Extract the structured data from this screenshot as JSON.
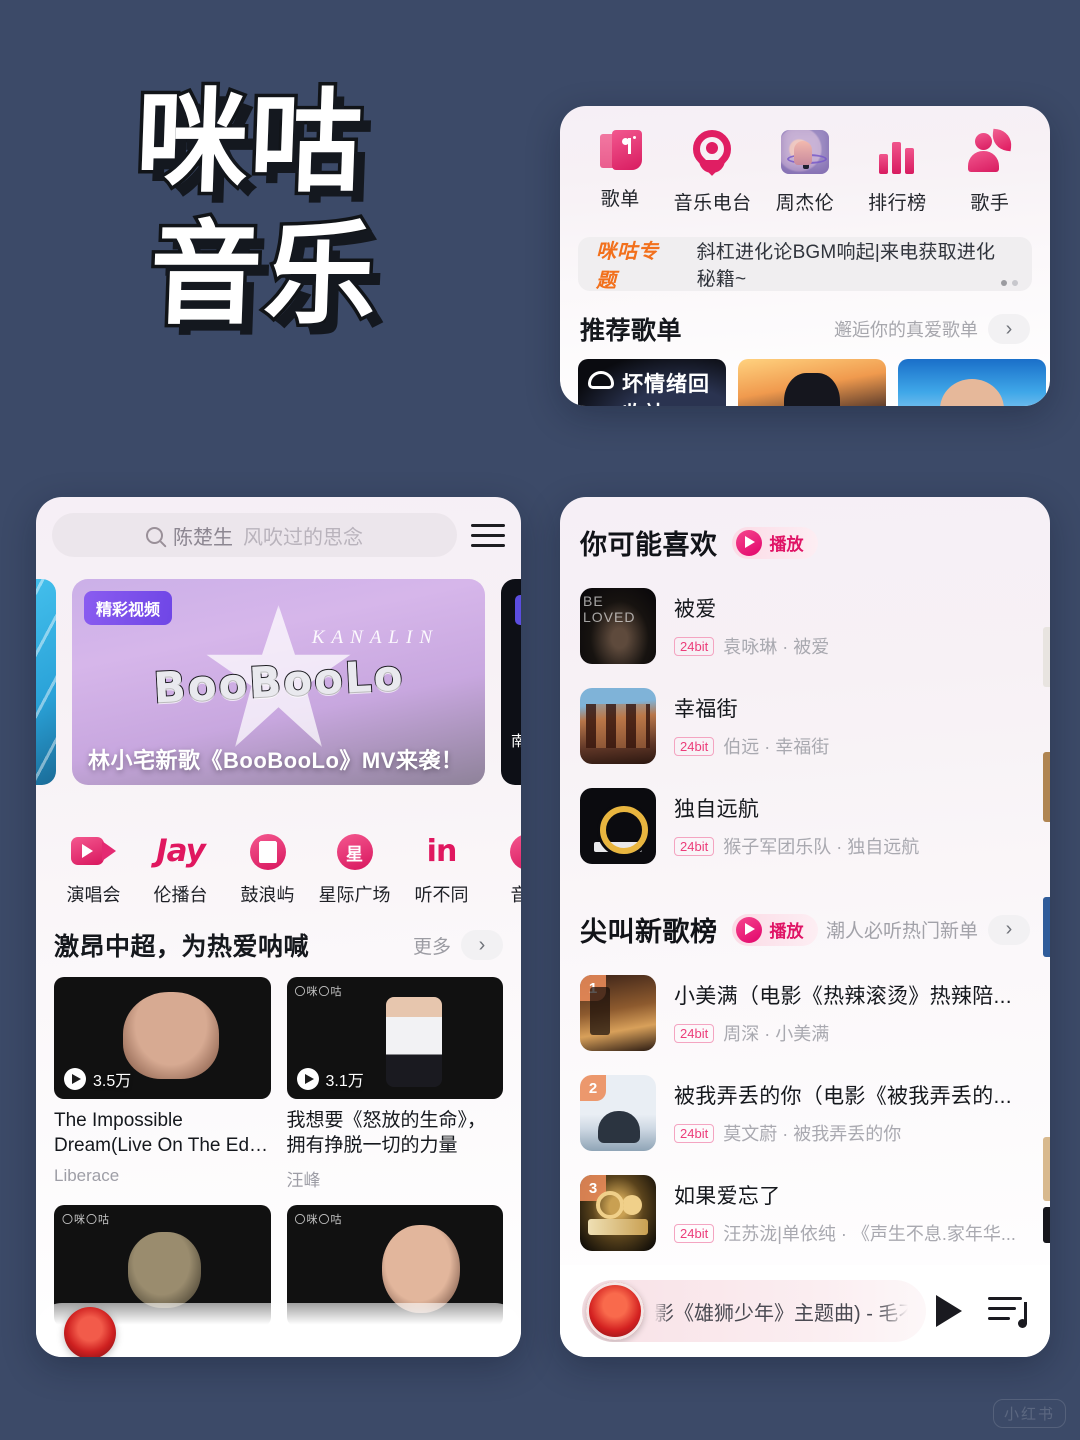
{
  "poster": {
    "line1": "咪咕",
    "line2": "音乐",
    "watermark": "小红书"
  },
  "nav_card": {
    "items": [
      {
        "label": "歌单",
        "icon": "playlist-icon"
      },
      {
        "label": "音乐电台",
        "icon": "radio-icon"
      },
      {
        "label": "周杰伦",
        "icon": "jay-chou-icon"
      },
      {
        "label": "排行榜",
        "icon": "chart-icon"
      },
      {
        "label": "歌手",
        "icon": "singer-icon"
      }
    ],
    "banner": {
      "tag": "咪咕专题",
      "text": "斜杠进化论BGM响起|来电获取进化秘籍~",
      "dots": 2,
      "active_dot": 1
    },
    "recommend": {
      "title": "推荐歌单",
      "subtitle": "邂逅你的真爱歌单",
      "chevron": "chevron-right-icon",
      "playlists": [
        {
          "title": "坏情绪回收站"
        },
        {
          "title": ""
        },
        {
          "title": ""
        },
        {
          "title": ""
        }
      ]
    }
  },
  "home_card": {
    "search": {
      "icon": "search-icon",
      "query_primary": "陈楚生",
      "query_secondary": "风吹过的思念",
      "menu_icon": "hamburger-menu-icon"
    },
    "hero": {
      "badge": "精彩视频",
      "artist_mark": "KANALIN",
      "art_text": "BooBooLo",
      "title": "林小宅新歌《BooBooLo》MV来袭！"
    },
    "quick_entries": [
      {
        "label": "演唱会",
        "icon": "video-camera-icon"
      },
      {
        "label": "伦播台",
        "icon": "jay-text-icon"
      },
      {
        "label": "鼓浪屿",
        "icon": "film-strip-icon"
      },
      {
        "label": "星际广场",
        "icon": "star-badge-icon"
      },
      {
        "label": "听不同",
        "icon": "in-text-icon"
      },
      {
        "label": "音乐",
        "icon": "partial-icon"
      }
    ],
    "section": {
      "title": "激昂中超，为热爱呐喊",
      "more": "更多",
      "chevron": "chevron-right-icon"
    },
    "videos": [
      {
        "title": "The Impossible Dream(Live On The Ed Sullivan Show, ...",
        "artist": "Liberace",
        "plays": "3.5万",
        "watermark": "",
        "thumb": "liberace"
      },
      {
        "title": "我想要《怒放的生命》，拥有挣脱一切的力量",
        "artist": "汪峰",
        "plays": "3.1万",
        "watermark": "〇咪〇咕",
        "thumb": "wangfeng"
      },
      {
        "title": "",
        "artist": "",
        "plays": "",
        "watermark": "〇咪〇咕",
        "thumb": "dark1"
      },
      {
        "title": "",
        "artist": "",
        "plays": "",
        "watermark": "〇咪〇咕",
        "thumb": "dark2"
      }
    ]
  },
  "discover_card": {
    "may_like": {
      "title": "你可能喜欢",
      "play_label": "播放",
      "play_icon": "play-circle-icon",
      "songs": [
        {
          "name": "被爱",
          "quality": "24bit",
          "artist": "袁咏琳 · 被爱",
          "cover": "beloved",
          "cover_text": "BE LOVED"
        },
        {
          "name": "幸福街",
          "quality": "24bit",
          "artist": "伯远 · 幸福街",
          "cover": "street",
          "cover_text": ""
        },
        {
          "name": "独自远航",
          "quality": "24bit",
          "artist": "猴子军团乐队 · 独自远航",
          "cover": "sail",
          "cover_text": ""
        }
      ]
    },
    "new_chart": {
      "title": "尖叫新歌榜",
      "play_label": "播放",
      "play_icon": "play-circle-icon",
      "subtitle": "潮人必听热门新单",
      "chevron": "chevron-right-icon",
      "songs": [
        {
          "rank": "1",
          "name": "小美满（电影《热辣滚烫》热辣陪...",
          "quality": "24bit",
          "artist": "周深 · 小美满",
          "cover": "xmm"
        },
        {
          "rank": "2",
          "name": "被我弄丢的你（电影《被我弄丢的...",
          "quality": "24bit",
          "artist": "莫文蔚 · 被我弄丢的你",
          "cover": "lost"
        },
        {
          "rank": "3",
          "name": "如果爱忘了",
          "quality": "24bit",
          "artist": "汪苏泷|单依纯 · 《声生不息.家年华...",
          "cover": "ruguo"
        }
      ]
    },
    "mini_player": {
      "track": "影《雄狮少年》主题曲) - 毛不易",
      "play_icon": "play-triangle-icon",
      "queue_icon": "playlist-queue-icon",
      "cover": "xiongshi-cover"
    }
  },
  "colors": {
    "background": "#3c4a68",
    "accent_pink": "#e0175f",
    "accent_orange": "#f2701c",
    "card_bg": "#f8f2f7"
  }
}
